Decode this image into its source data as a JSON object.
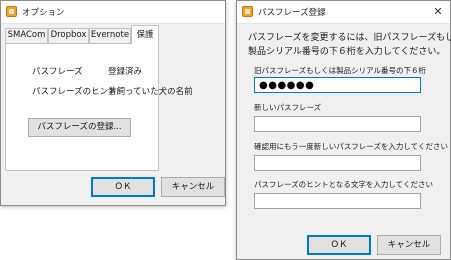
{
  "options_window": {
    "title": "オプション",
    "close_glyph": "✕",
    "tabs": [
      {
        "label": "SMACom"
      },
      {
        "label": "Dropbox"
      },
      {
        "label": "Evernote"
      },
      {
        "label": "保護"
      }
    ],
    "rows": [
      {
        "label": "パスフレーズ",
        "value": "登録済み"
      },
      {
        "label": "パスフレーズのヒント",
        "value": "昔飼っていた犬の名前"
      }
    ],
    "register_button": "パスフレーズの登録...",
    "ok_button": "ＯＫ",
    "cancel_button": "キャンセル"
  },
  "passphrase_window": {
    "title": "パスフレーズ登録",
    "close_glyph": "✕",
    "instructions": [
      "パスフレーズを変更するには、旧パスフレーズもしくは",
      "製品シリアル番号の下６桁を入力してください。"
    ],
    "fields": [
      {
        "label": "旧パスフレーズもしくは製品シリアル番号の下６桁",
        "value": "●●●●●●"
      },
      {
        "label": "新しいパスフレーズ",
        "value": ""
      },
      {
        "label": "確認用にもう一度新しいパスフレーズを入力してください",
        "value": ""
      },
      {
        "label": "パスフレーズのヒントとなる文字を入力してください",
        "value": ""
      }
    ],
    "ok_button": "ＯＫ",
    "cancel_button": "キャンセル"
  },
  "colors": {
    "focus_border": "#0078d7",
    "window_bg": "#f0f0f0",
    "button_bg": "#e1e1e1"
  }
}
